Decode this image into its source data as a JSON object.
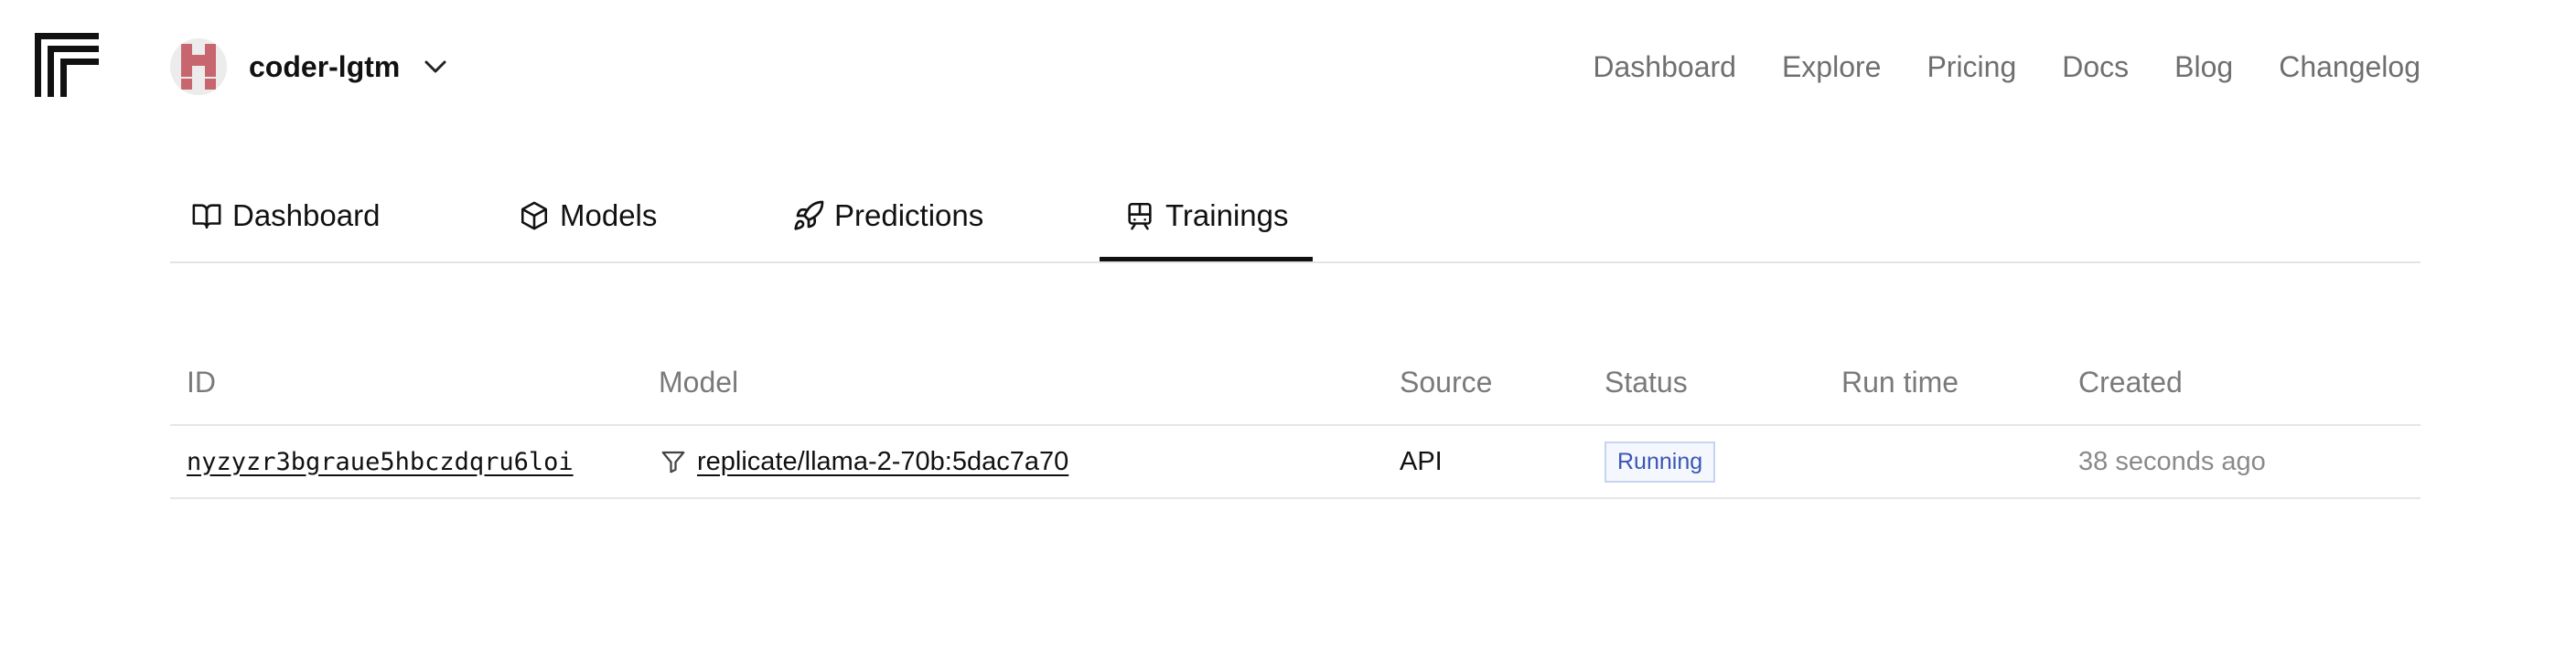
{
  "header": {
    "account": {
      "name": "coder-lgtm"
    },
    "nav": [
      {
        "label": "Dashboard"
      },
      {
        "label": "Explore"
      },
      {
        "label": "Pricing"
      },
      {
        "label": "Docs"
      },
      {
        "label": "Blog"
      },
      {
        "label": "Changelog"
      }
    ]
  },
  "tabs": [
    {
      "label": "Dashboard",
      "icon": "book-open-icon"
    },
    {
      "label": "Models",
      "icon": "cube-icon"
    },
    {
      "label": "Predictions",
      "icon": "rocket-icon"
    },
    {
      "label": "Trainings",
      "icon": "train-icon",
      "active": true
    }
  ],
  "table": {
    "columns": [
      "ID",
      "Model",
      "Source",
      "Status",
      "Run time",
      "Created"
    ],
    "rows": [
      {
        "id": "nyzyzr3bgraue5hbczdqru6loi",
        "model": "replicate/llama-2-70b:5dac7a70",
        "source": "API",
        "status": "Running",
        "run_time": "",
        "created": "38 seconds ago"
      }
    ]
  },
  "colors": {
    "text": "#111111",
    "muted": "#7a7a7a",
    "status_running_text": "#3a56b4",
    "status_running_border": "#c7d4f0",
    "avatar_accent": "#c7666f"
  }
}
